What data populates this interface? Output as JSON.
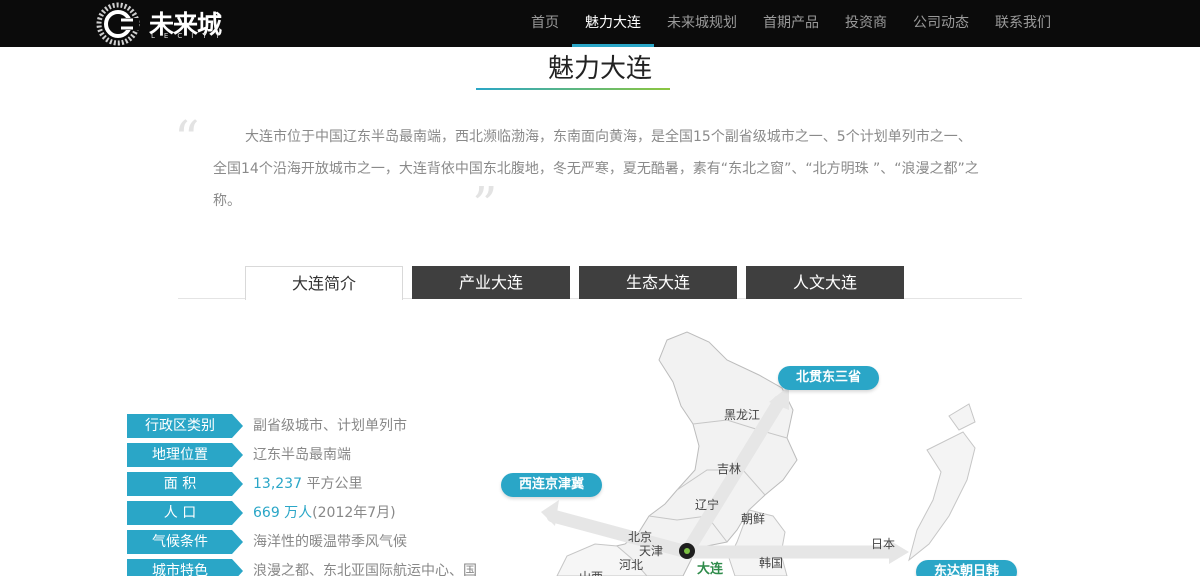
{
  "header": {
    "logo_text": "未来城",
    "logo_sub": "LECITY",
    "nav": [
      {
        "label": "首页",
        "active": false
      },
      {
        "label": "魅力大连",
        "active": true
      },
      {
        "label": "未来城规划",
        "active": false
      },
      {
        "label": "首期产品",
        "active": false
      },
      {
        "label": "投资商",
        "active": false
      },
      {
        "label": "公司动态",
        "active": false
      },
      {
        "label": "联系我们",
        "active": false
      }
    ]
  },
  "section": {
    "title": "魅力大连",
    "intro": "大连市位于中国辽东半岛最南端，西北濒临渤海，东南面向黄海，是全国15个副省级城市之一、5个计划单列市之一、全国14个沿海开放城市之一，大连背依中国东北腹地，冬无严寒，夏无酷暑，素有“东北之窗”、“北方明珠 ”、“浪漫之都”之称。",
    "quote_open": "“",
    "quote_close": "”"
  },
  "tabs": [
    {
      "label": "大连简介",
      "active": true
    },
    {
      "label": "产业大连",
      "active": false
    },
    {
      "label": "生态大连",
      "active": false
    },
    {
      "label": "人文大连",
      "active": false
    }
  ],
  "info": {
    "rows": [
      {
        "label": "行政区类别",
        "value": "副省级城市、计划单列市"
      },
      {
        "label": "地理位置",
        "value": "辽东半岛最南端"
      },
      {
        "label": "面 积",
        "num": "13,237",
        "value": " 平方公里"
      },
      {
        "label": "人 口",
        "num": "669 万人",
        "value": "(2012年7月)"
      },
      {
        "label": "气候条件",
        "value": "海洋性的暖温带季风气候"
      },
      {
        "label": "城市特色",
        "value": "浪漫之都、东北亚国际航运中心、国"
      }
    ]
  },
  "map": {
    "pills": {
      "north": "北贯东三省",
      "west": "西连京津冀",
      "east": "东达朝日韩"
    },
    "places": {
      "heilongjiang": "黑龙江",
      "jilin": "吉林",
      "liaoning": "辽宁",
      "korea": "朝鲜",
      "beijing": "北京",
      "tianjin": "天津",
      "hebei": "河北",
      "shanxi": "山西",
      "south_korea": "韩国",
      "japan": "日本",
      "dalian": "大连"
    }
  },
  "colors": {
    "accent": "#2aa6c7",
    "accent_green": "#8cc63f",
    "header_bg": "#0b0b0b",
    "tab_dark": "#3f3f3f"
  }
}
